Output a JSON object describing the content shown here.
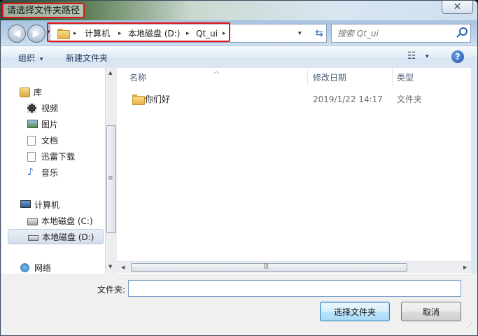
{
  "window": {
    "title": "请选择文件夹路径",
    "close_glyph": "✕"
  },
  "nav": {
    "back_glyph": "◀",
    "forward_glyph": "▶",
    "recent_glyph": "▾",
    "breadcrumbs": [
      "计算机",
      "本地磁盘 (D:)",
      "Qt_ui"
    ],
    "crumb_separator": "▸",
    "address_dropdown_glyph": "▾",
    "refresh_glyph": "⇆",
    "search_placeholder": "搜索 Qt_ui"
  },
  "toolbar": {
    "organize_label": "组织",
    "organize_arrow": "▾",
    "new_folder_label": "新建文件夹",
    "view_glyph": "☷",
    "view_arrow": "▾",
    "help_glyph": "?"
  },
  "sidebar": {
    "items": [
      {
        "label": "库",
        "icon": "library-icon"
      },
      {
        "label": "视频",
        "icon": "video-icon"
      },
      {
        "label": "图片",
        "icon": "pictures-icon"
      },
      {
        "label": "文档",
        "icon": "documents-icon"
      },
      {
        "label": "迅雷下载",
        "icon": "download-icon"
      },
      {
        "label": "音乐",
        "icon": "music-icon"
      },
      {
        "label": "计算机",
        "icon": "computer-icon"
      },
      {
        "label": "本地磁盘 (C:)",
        "icon": "system-drive-icon"
      },
      {
        "label": "本地磁盘 (D:)",
        "icon": "drive-icon",
        "selected": true
      },
      {
        "label": "网络",
        "icon": "network-icon"
      }
    ]
  },
  "file_list": {
    "columns": [
      "名称",
      "修改日期",
      "类型"
    ],
    "rows": [
      {
        "name": "你们好",
        "modified": "2019/1/22 14:17",
        "type": "文件夹",
        "icon": "folder-icon"
      }
    ]
  },
  "scrollbars": {
    "up_glyph": "▲",
    "down_glyph": "▼",
    "left_glyph": "◀",
    "right_glyph": "▶",
    "grip_glyph": "≡",
    "hgrip_glyph": "|||"
  },
  "footer": {
    "filename_label": "文件夹:",
    "filename_value": "",
    "select_button": "选择文件夹",
    "cancel_button": "取消"
  },
  "colors": {
    "highlight_border": "#e0161a",
    "accent": "#2a64b4"
  }
}
